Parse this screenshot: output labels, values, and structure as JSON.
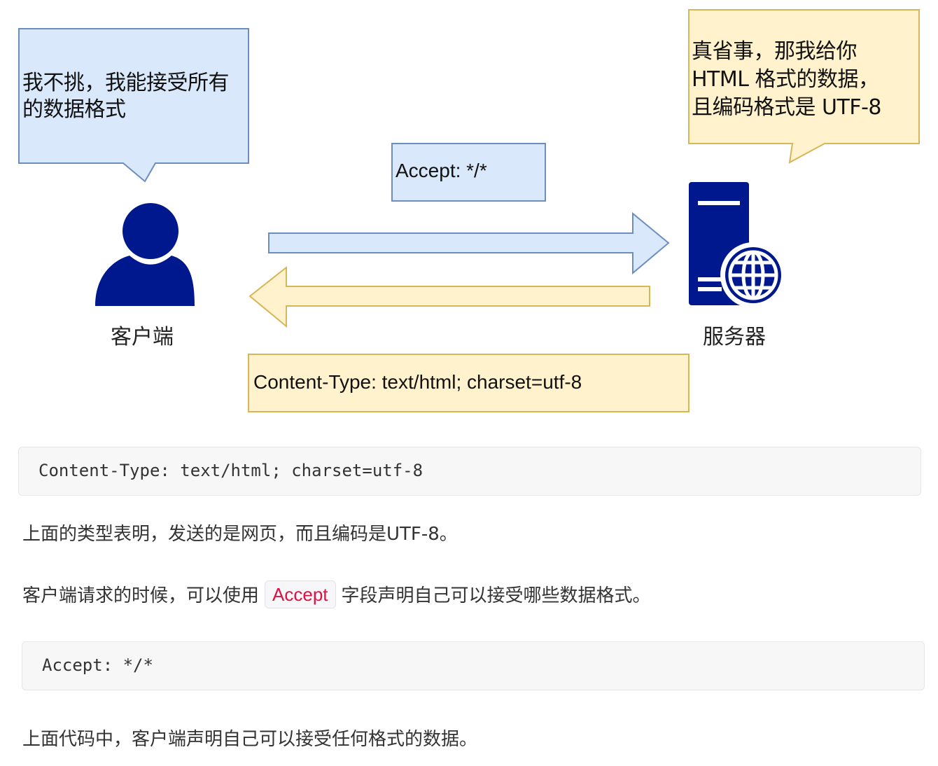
{
  "diagram": {
    "client_bubble": "我不挑，我能接受所有的数据格式",
    "server_bubble_lines": [
      "真省事，那我给你",
      "HTML 格式的数据，",
      "且编码格式是 UTF-8"
    ],
    "request_header": "Accept: */*",
    "response_header": "Content-Type: text/html; charset=utf-8",
    "client_label": "客户端",
    "server_label": "服务器",
    "colors": {
      "client_bubble_fill": "#dae8fc",
      "client_bubble_stroke": "#6c8ebf",
      "server_bubble_fill": "#fff2cc",
      "server_bubble_stroke": "#d6b656",
      "icon": "#00188d"
    },
    "icons": [
      "user-icon",
      "server-icon",
      "globe-icon",
      "arrow-right-icon",
      "arrow-left-icon"
    ]
  },
  "code1": "Content-Type: text/html; charset=utf-8",
  "para1": "上面的类型表明，发送的是网页，而且编码是UTF-8。",
  "para2": {
    "before": "客户端请求的时候，可以使用",
    "code": "Accept",
    "after": "字段声明自己可以接受哪些数据格式。"
  },
  "code2": "Accept: */*",
  "para3": "上面代码中，客户端声明自己可以接受任何格式的数据。"
}
